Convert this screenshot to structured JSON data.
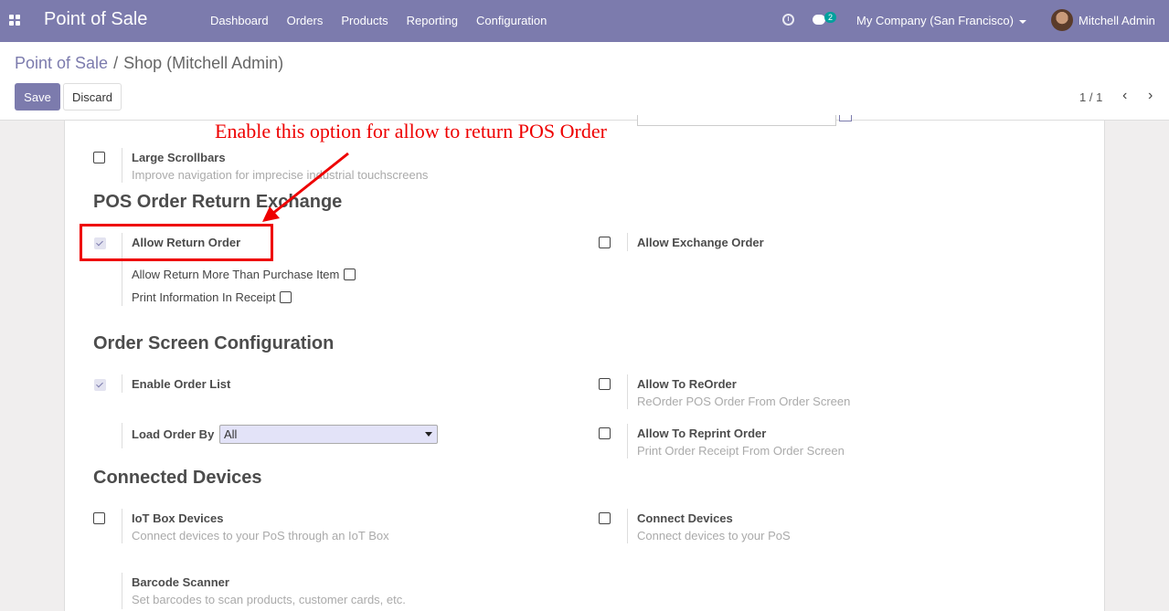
{
  "navbar": {
    "brand": "Point of Sale",
    "menu": [
      "Dashboard",
      "Orders",
      "Products",
      "Reporting",
      "Configuration"
    ],
    "chat_count": "2",
    "company": "My Company (San Francisco)",
    "user": "Mitchell Admin"
  },
  "breadcrumb": {
    "root": "Point of Sale",
    "separator": "/",
    "current": "Shop (Mitchell Admin)"
  },
  "toolbar": {
    "save_label": "Save",
    "discard_label": "Discard"
  },
  "pager": {
    "value": "1 / 1"
  },
  "settings": {
    "large_scrollbars": {
      "label": "Large Scrollbars",
      "desc": "Improve navigation for imprecise industrial touchscreens",
      "checked": false
    },
    "return_section": {
      "heading": "POS Order Return Exchange",
      "allow_return": {
        "label": "Allow Return Order",
        "checked": true
      },
      "allow_return_more": {
        "label": "Allow Return More Than Purchase Item",
        "checked": false
      },
      "print_info": {
        "label": "Print Information In Receipt",
        "checked": false
      },
      "allow_exchange": {
        "label": "Allow Exchange Order",
        "checked": false
      }
    },
    "order_screen": {
      "heading": "Order Screen Configuration",
      "enable_order_list": {
        "label": "Enable Order List",
        "checked": true
      },
      "load_order_by": {
        "label": "Load Order By",
        "value": "All"
      },
      "allow_reorder": {
        "label": "Allow To ReOrder",
        "desc": "ReOrder POS Order From Order Screen",
        "checked": false
      },
      "allow_reprint": {
        "label": "Allow To Reprint Order",
        "desc": "Print Order Receipt From Order Screen",
        "checked": false
      }
    },
    "devices": {
      "heading": "Connected Devices",
      "iot_box": {
        "label": "IoT Box Devices",
        "desc": "Connect devices to your PoS through an IoT Box",
        "checked": false
      },
      "connect_devices": {
        "label": "Connect Devices",
        "desc": "Connect devices to your PoS",
        "checked": false
      },
      "barcode": {
        "label": "Barcode Scanner",
        "desc": "Set barcodes to scan products, customer cards, etc."
      }
    }
  },
  "annotation": {
    "text": "Enable this option for allow to return POS Order",
    "color": "#ee0000"
  },
  "colors": {
    "brand": "#7c7bad",
    "teal": "#00a09d"
  }
}
